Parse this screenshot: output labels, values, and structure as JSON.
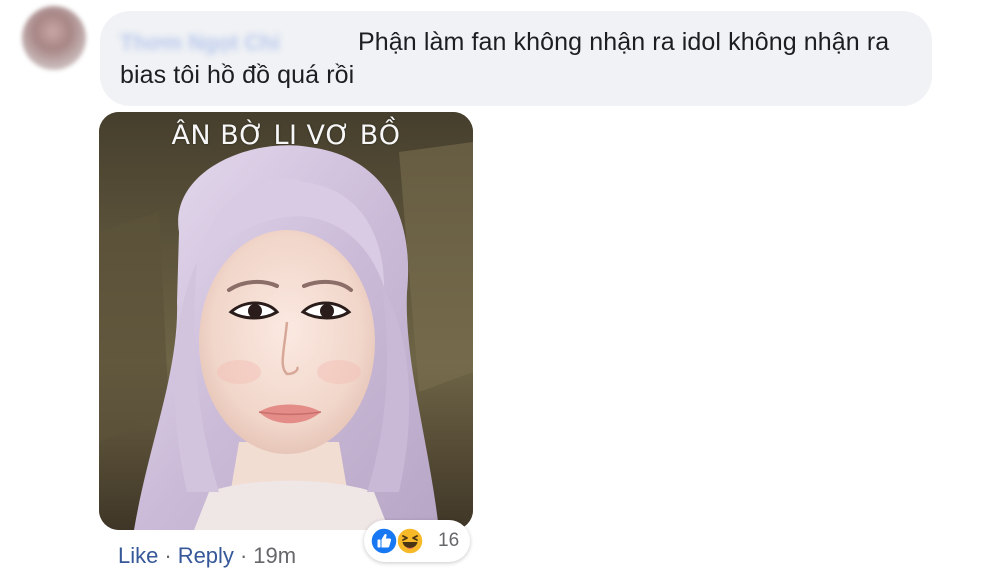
{
  "comment": {
    "author_name": "Thơm Ngọt Chi",
    "text": "Phận làm fan không nhận ra idol không nhận ra bias tôi hồ đồ quá rồi"
  },
  "meme": {
    "caption": "ÂN BỜ LI VƠ BỒ"
  },
  "actions": {
    "like_label": "Like",
    "separator": "·",
    "reply_label": "Reply",
    "timestamp": "19m"
  },
  "reactions": {
    "icons": [
      "like-icon",
      "haha-icon"
    ],
    "count": "16"
  },
  "colors": {
    "bubble_bg": "#f0f2f5",
    "link": "#365899",
    "meta_gray": "#65676b",
    "like_blue": "#1877f2",
    "haha_yellow": "#f7b928"
  }
}
